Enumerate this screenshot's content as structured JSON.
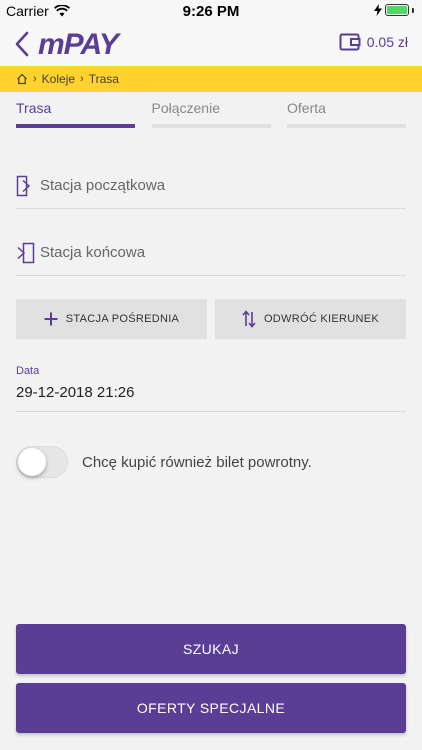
{
  "status_bar": {
    "carrier": "Carrier",
    "time": "9:26 PM"
  },
  "nav": {
    "brand": "mPAY",
    "wallet_balance": "0.05 zł"
  },
  "breadcrumb": [
    "Koleje",
    "Trasa"
  ],
  "steps": [
    {
      "label": "Trasa",
      "active": true
    },
    {
      "label": "Połączenie",
      "active": false
    },
    {
      "label": "Oferta",
      "active": false
    }
  ],
  "form": {
    "start_placeholder": "Stacja początkowa",
    "end_placeholder": "Stacja końcowa",
    "add_via_label": "STACJA POŚREDNIA",
    "reverse_label": "ODWRÓĆ KIERUNEK",
    "date_label": "Data",
    "date_value": "29-12-2018 21:26",
    "return_ticket_label": "Chcę kupić również bilet powrotny.",
    "return_ticket_on": false
  },
  "actions": {
    "search_label": "SZUKAJ",
    "special_offers_label": "OFERTY SPECJALNE"
  },
  "colors": {
    "accent": "#5a3e96",
    "breadcrumb_bg": "#ffd230",
    "battery": "#4cd964"
  }
}
